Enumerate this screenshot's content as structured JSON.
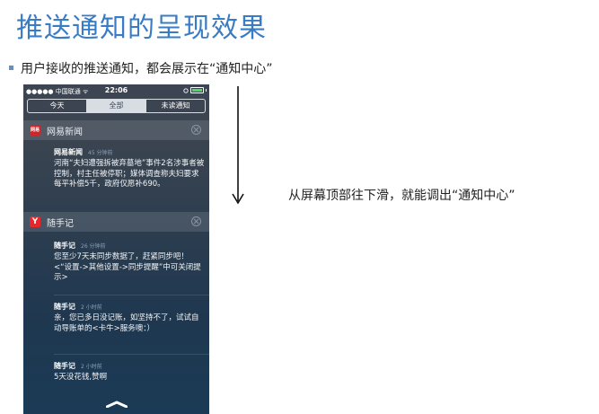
{
  "slide": {
    "title": "推送通知的呈现效果",
    "bullet": "用户接收的推送通知，都会展示在“通知中心”",
    "hint": "从屏幕顶部往下滑，就能调出“通知中心”"
  },
  "phone": {
    "status": {
      "carrier": "●●●●● 中国联通 ᯤ",
      "time": "22:06"
    },
    "tabs": [
      {
        "label": "今天",
        "active": false
      },
      {
        "label": "全部",
        "active": true
      },
      {
        "label": "未读通知",
        "active": false
      }
    ],
    "groups": [
      {
        "app_name": "网易新闻",
        "icon_text": "网易",
        "icon_color": "#d0262b",
        "notes": [
          {
            "title": "网易新闻",
            "time": "45 分钟前",
            "body": "河南“夫妇遭强拆被弃墓地”事件2名涉事者被控制，村主任被停职；媒体调查称夫妇要求每平补偿5千，政府仅愿补690。"
          }
        ]
      },
      {
        "app_name": "随手记",
        "icon_text": "Y",
        "icon_color": "#e8262c",
        "notes": [
          {
            "title": "随手记",
            "time": "26 分钟前",
            "body": "您至少7天未同步数据了，赶紧同步吧！<“设置->其他设置->同步提醒”中可关闭提示>"
          },
          {
            "title": "随手记",
            "time": "2 小时前",
            "body": "亲，您已多日没记账，如坚持不了，试试自动导账单的<卡牛>服务噢：）"
          },
          {
            "title": "随手记",
            "time": "2 小时前",
            "body": "5天没花钱,赞啊"
          }
        ]
      }
    ]
  }
}
